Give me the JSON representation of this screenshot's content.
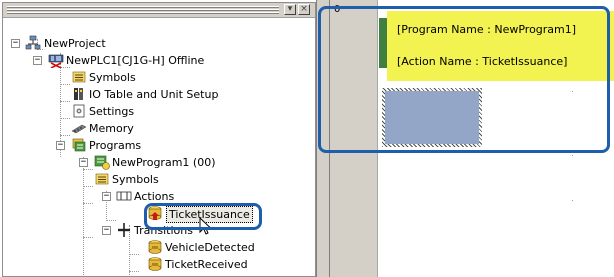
{
  "window": {
    "buttons": {
      "menu": "▾",
      "close": "×"
    }
  },
  "tree": {
    "items": [
      {
        "id": "newproject",
        "label": "NewProject",
        "icon": "project-icon",
        "expander": "−"
      },
      {
        "id": "newplc1",
        "label": "NewPLC1[CJ1G-H] Offline",
        "icon": "plc-offline-icon",
        "expander": "−"
      },
      {
        "id": "symbols",
        "label": "Symbols",
        "icon": "symbols-icon"
      },
      {
        "id": "io-table",
        "label": "IO Table and Unit Setup",
        "icon": "io-table-icon"
      },
      {
        "id": "settings",
        "label": "Settings",
        "icon": "settings-icon"
      },
      {
        "id": "memory",
        "label": "Memory",
        "icon": "memory-icon"
      },
      {
        "id": "programs",
        "label": "Programs",
        "icon": "programs-icon",
        "expander": "−"
      },
      {
        "id": "newprogram1",
        "label": "NewProgram1 (00)",
        "icon": "program-icon",
        "expander": "−"
      },
      {
        "id": "prog-symbols",
        "label": "Symbols",
        "icon": "symbols-icon"
      },
      {
        "id": "actions",
        "label": "Actions",
        "icon": "actions-folder-icon",
        "expander": "−"
      },
      {
        "id": "ticketissuance",
        "label": "TicketIssuance",
        "icon": "action-icon",
        "selected": true
      },
      {
        "id": "transitions",
        "label": "Transitions",
        "icon": "transitions-icon",
        "expander": "−"
      },
      {
        "id": "vehicledetected",
        "label": "VehicleDetected",
        "icon": "transition-item-icon"
      },
      {
        "id": "ticketreceived",
        "label": "TicketReceived",
        "icon": "transition-item-icon"
      }
    ]
  },
  "editor": {
    "rung_number": "0",
    "comment_lines": [
      "[Program Name : NewProgram1]",
      "[Action Name : TicketIssuance]"
    ]
  },
  "colors": {
    "highlight": "#1f5eaa",
    "comment_bg": "#f2f250",
    "rung_bar": "#3f7f3f",
    "step_block": "#94a6c8"
  }
}
